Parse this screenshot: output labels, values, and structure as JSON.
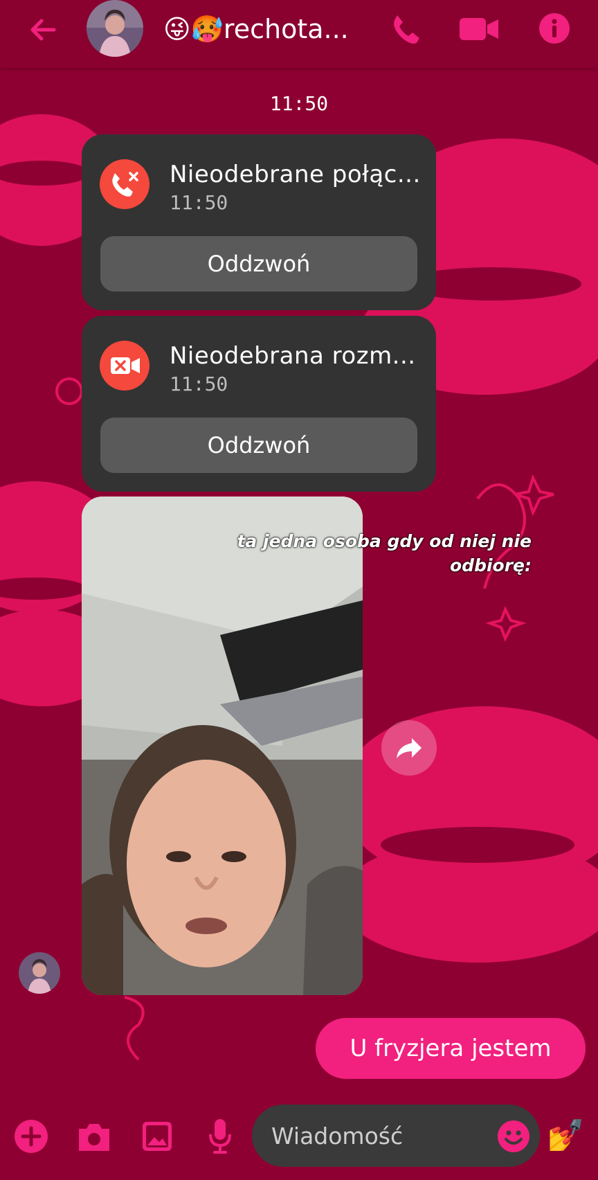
{
  "header": {
    "back_icon": "arrow-left-icon",
    "title": "😜🥵rechota...",
    "call_icon": "phone-icon",
    "video_icon": "video-camera-icon",
    "info_icon": "info-icon"
  },
  "thread": {
    "timestamp": "11:50",
    "calls": [
      {
        "icon": "missed-call-icon",
        "title": "Nieodebrane połąc...",
        "time": "11:50",
        "action": "Oddzwoń"
      },
      {
        "icon": "missed-video-call-icon",
        "title": "Nieodebrana rozm...",
        "time": "11:50",
        "action": "Oddzwoń"
      }
    ],
    "video_caption": "ta jedna osoba gdy od niej nie odbiorę:",
    "share_icon": "share-arrow-icon",
    "sent_message": "U fryzjera jestem"
  },
  "composer": {
    "add_icon": "plus-icon",
    "camera_icon": "camera-icon",
    "gallery_icon": "image-icon",
    "mic_icon": "microphone-icon",
    "placeholder": "Wiadomość",
    "emoji_icon": "smiley-icon",
    "reaction": "💅"
  },
  "colors": {
    "background": "#8f0032",
    "accent": "#f2207e",
    "card": "#333333",
    "missed": "#f4493c"
  }
}
